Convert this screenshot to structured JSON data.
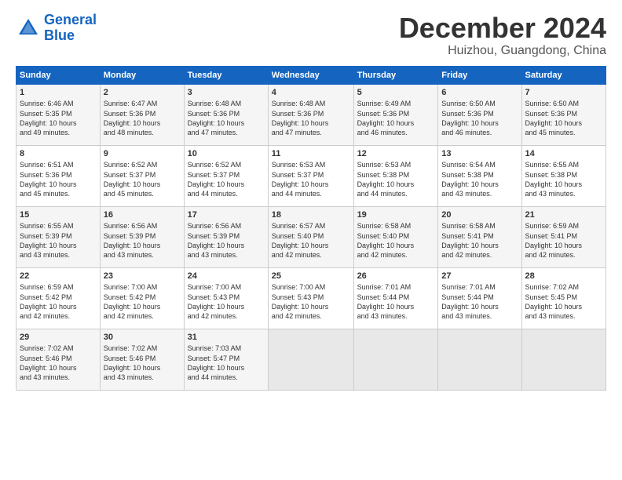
{
  "logo": {
    "line1": "General",
    "line2": "Blue"
  },
  "title": "December 2024",
  "location": "Huizhou, Guangdong, China",
  "columns": [
    "Sunday",
    "Monday",
    "Tuesday",
    "Wednesday",
    "Thursday",
    "Friday",
    "Saturday"
  ],
  "weeks": [
    [
      {
        "day": "1",
        "info": "Sunrise: 6:46 AM\nSunset: 5:35 PM\nDaylight: 10 hours\nand 49 minutes."
      },
      {
        "day": "2",
        "info": "Sunrise: 6:47 AM\nSunset: 5:36 PM\nDaylight: 10 hours\nand 48 minutes."
      },
      {
        "day": "3",
        "info": "Sunrise: 6:48 AM\nSunset: 5:36 PM\nDaylight: 10 hours\nand 47 minutes."
      },
      {
        "day": "4",
        "info": "Sunrise: 6:48 AM\nSunset: 5:36 PM\nDaylight: 10 hours\nand 47 minutes."
      },
      {
        "day": "5",
        "info": "Sunrise: 6:49 AM\nSunset: 5:36 PM\nDaylight: 10 hours\nand 46 minutes."
      },
      {
        "day": "6",
        "info": "Sunrise: 6:50 AM\nSunset: 5:36 PM\nDaylight: 10 hours\nand 46 minutes."
      },
      {
        "day": "7",
        "info": "Sunrise: 6:50 AM\nSunset: 5:36 PM\nDaylight: 10 hours\nand 45 minutes."
      }
    ],
    [
      {
        "day": "8",
        "info": "Sunrise: 6:51 AM\nSunset: 5:36 PM\nDaylight: 10 hours\nand 45 minutes."
      },
      {
        "day": "9",
        "info": "Sunrise: 6:52 AM\nSunset: 5:37 PM\nDaylight: 10 hours\nand 45 minutes."
      },
      {
        "day": "10",
        "info": "Sunrise: 6:52 AM\nSunset: 5:37 PM\nDaylight: 10 hours\nand 44 minutes."
      },
      {
        "day": "11",
        "info": "Sunrise: 6:53 AM\nSunset: 5:37 PM\nDaylight: 10 hours\nand 44 minutes."
      },
      {
        "day": "12",
        "info": "Sunrise: 6:53 AM\nSunset: 5:38 PM\nDaylight: 10 hours\nand 44 minutes."
      },
      {
        "day": "13",
        "info": "Sunrise: 6:54 AM\nSunset: 5:38 PM\nDaylight: 10 hours\nand 43 minutes."
      },
      {
        "day": "14",
        "info": "Sunrise: 6:55 AM\nSunset: 5:38 PM\nDaylight: 10 hours\nand 43 minutes."
      }
    ],
    [
      {
        "day": "15",
        "info": "Sunrise: 6:55 AM\nSunset: 5:39 PM\nDaylight: 10 hours\nand 43 minutes."
      },
      {
        "day": "16",
        "info": "Sunrise: 6:56 AM\nSunset: 5:39 PM\nDaylight: 10 hours\nand 43 minutes."
      },
      {
        "day": "17",
        "info": "Sunrise: 6:56 AM\nSunset: 5:39 PM\nDaylight: 10 hours\nand 43 minutes."
      },
      {
        "day": "18",
        "info": "Sunrise: 6:57 AM\nSunset: 5:40 PM\nDaylight: 10 hours\nand 42 minutes."
      },
      {
        "day": "19",
        "info": "Sunrise: 6:58 AM\nSunset: 5:40 PM\nDaylight: 10 hours\nand 42 minutes."
      },
      {
        "day": "20",
        "info": "Sunrise: 6:58 AM\nSunset: 5:41 PM\nDaylight: 10 hours\nand 42 minutes."
      },
      {
        "day": "21",
        "info": "Sunrise: 6:59 AM\nSunset: 5:41 PM\nDaylight: 10 hours\nand 42 minutes."
      }
    ],
    [
      {
        "day": "22",
        "info": "Sunrise: 6:59 AM\nSunset: 5:42 PM\nDaylight: 10 hours\nand 42 minutes."
      },
      {
        "day": "23",
        "info": "Sunrise: 7:00 AM\nSunset: 5:42 PM\nDaylight: 10 hours\nand 42 minutes."
      },
      {
        "day": "24",
        "info": "Sunrise: 7:00 AM\nSunset: 5:43 PM\nDaylight: 10 hours\nand 42 minutes."
      },
      {
        "day": "25",
        "info": "Sunrise: 7:00 AM\nSunset: 5:43 PM\nDaylight: 10 hours\nand 42 minutes."
      },
      {
        "day": "26",
        "info": "Sunrise: 7:01 AM\nSunset: 5:44 PM\nDaylight: 10 hours\nand 43 minutes."
      },
      {
        "day": "27",
        "info": "Sunrise: 7:01 AM\nSunset: 5:44 PM\nDaylight: 10 hours\nand 43 minutes."
      },
      {
        "day": "28",
        "info": "Sunrise: 7:02 AM\nSunset: 5:45 PM\nDaylight: 10 hours\nand 43 minutes."
      }
    ],
    [
      {
        "day": "29",
        "info": "Sunrise: 7:02 AM\nSunset: 5:46 PM\nDaylight: 10 hours\nand 43 minutes."
      },
      {
        "day": "30",
        "info": "Sunrise: 7:02 AM\nSunset: 5:46 PM\nDaylight: 10 hours\nand 43 minutes."
      },
      {
        "day": "31",
        "info": "Sunrise: 7:03 AM\nSunset: 5:47 PM\nDaylight: 10 hours\nand 44 minutes."
      },
      {
        "day": "",
        "info": ""
      },
      {
        "day": "",
        "info": ""
      },
      {
        "day": "",
        "info": ""
      },
      {
        "day": "",
        "info": ""
      }
    ]
  ]
}
